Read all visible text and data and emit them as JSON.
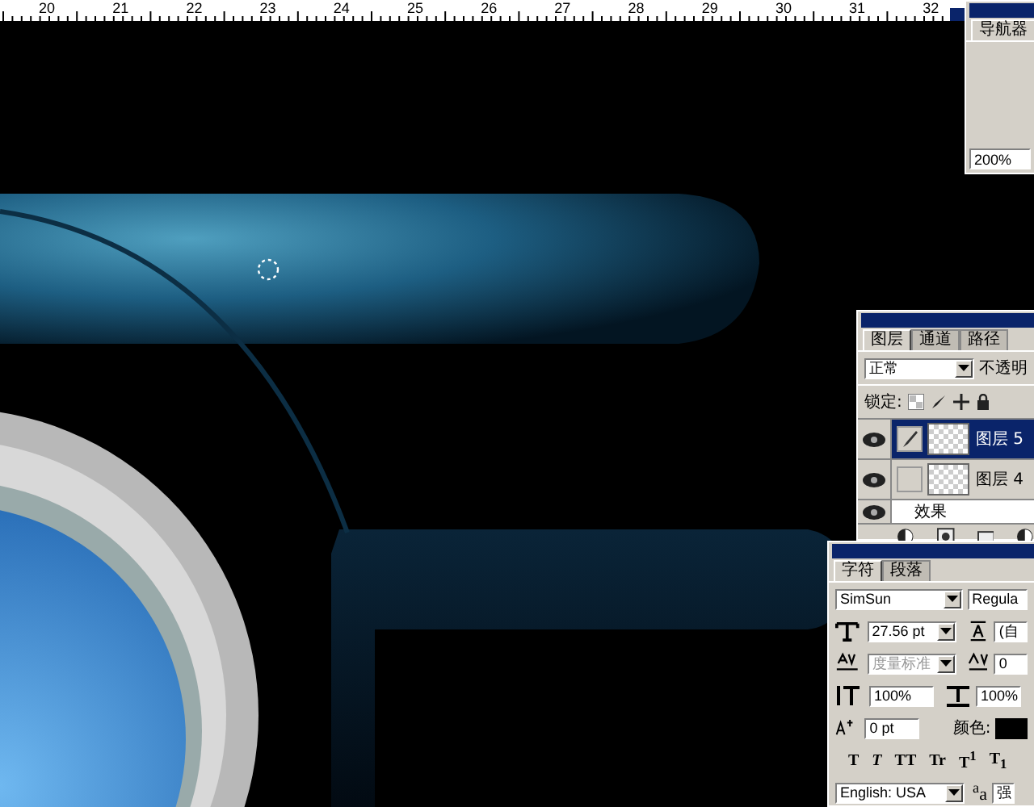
{
  "ruler": {
    "labels": [
      "20",
      "21",
      "22",
      "23",
      "24",
      "25",
      "26",
      "27",
      "28",
      "29",
      "30",
      "31",
      "32"
    ]
  },
  "navigator": {
    "tab": "导航器",
    "zoom": "200%"
  },
  "layers_panel": {
    "tabs": [
      {
        "label": "图层",
        "selected": true
      },
      {
        "label": "通道",
        "selected": false
      },
      {
        "label": "路径",
        "selected": false
      }
    ],
    "blend_mode": "正常",
    "opacity_label": "不透明",
    "lock_label": "锁定:",
    "layers": [
      {
        "kind": "layer",
        "name": "图层 5",
        "selected": true,
        "visible": true
      },
      {
        "kind": "layer",
        "name": "图层 4",
        "selected": false,
        "visible": true
      },
      {
        "kind": "effect",
        "name": "效果",
        "visible": true
      }
    ]
  },
  "character_panel": {
    "tabs": [
      {
        "label": "字符",
        "selected": true
      },
      {
        "label": "段落",
        "selected": false
      }
    ],
    "font": "SimSun",
    "font_style": "Regula",
    "size": "27.56 pt",
    "leading": "(自",
    "kerning": {
      "value": "度量标准",
      "disabled": true
    },
    "tracking": "0",
    "vertical_scale": "100%",
    "horizontal_scale": "100%",
    "baseline_shift": "0 pt",
    "color_label": "颜色:",
    "style_buttons": [
      "T",
      "T",
      "TT",
      "Tr",
      "T$^{1}$",
      "T$_{1}$"
    ],
    "language": "English: USA",
    "antialias_label": "$^{a}$a",
    "antialias": "强"
  }
}
